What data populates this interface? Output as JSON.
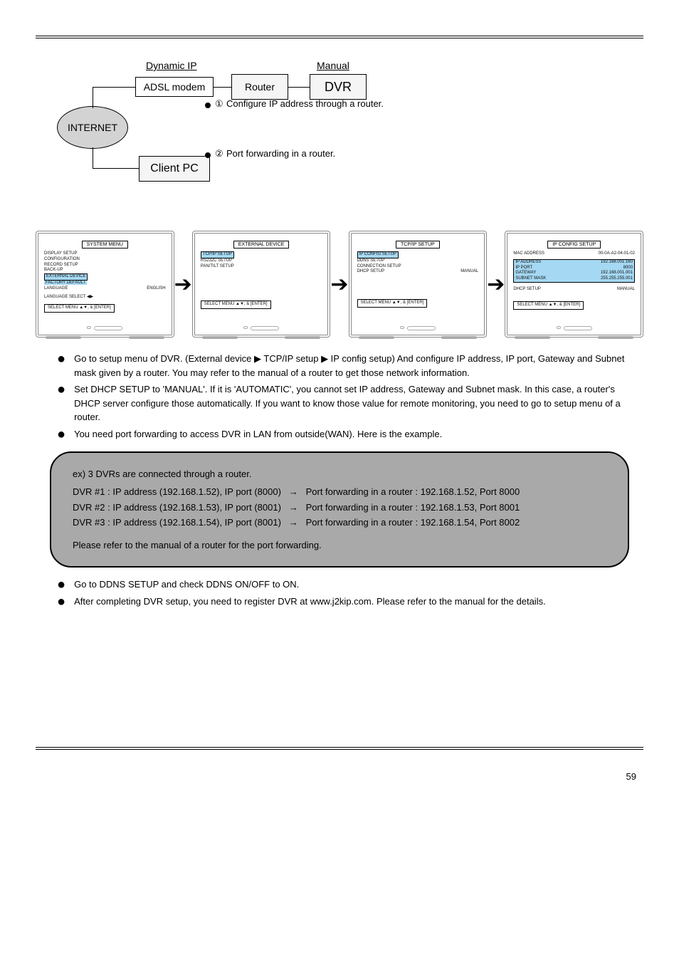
{
  "diagram": {
    "label_dynamic_ip": "Dynamic IP",
    "label_manual": "Manual",
    "node_adsl": "ADSL modem",
    "node_router": "Router",
    "node_dvr": "DVR",
    "node_internet": "INTERNET",
    "node_client_pc": "Client PC",
    "caption1_num": "①",
    "caption1_text": "Configure IP address through a router.",
    "caption2_num": "②",
    "caption2_text": "Port forwarding in a router."
  },
  "screens": {
    "s1": {
      "title": "SYSTEM MENU",
      "items": [
        "DISPLAY SETUP",
        "CONFIGURATION",
        "RECORD SETUP",
        "BACK-UP"
      ],
      "hi1": "EXTERNAL DEVICE",
      "hi2": "FACTORY DEFAULT",
      "lang_row_l": "LANGUAGE",
      "lang_row_r": "ENGLISH",
      "lang_sel": "LANGUAGE SELECT  ◀▶",
      "footer": "SELECT MENU ▲▼, & [ENTER]"
    },
    "s2": {
      "title": "EXTERNAL DEVICE",
      "hi": "TCP/IP SETUP",
      "items": [
        "RS232C SETUP",
        "PAN/TILT SETUP"
      ],
      "footer": "SELECT MENU ▲▼, & [ENTER]"
    },
    "s3": {
      "title": "TCP/IP SETUP",
      "hi": "IP CONFIG SETUP",
      "items": [
        "DDNS SETUP",
        "CONNECTION SETUP"
      ],
      "dhcp_l": "DHCP SETUP",
      "dhcp_r": "MANUAL",
      "footer": "SELECT MENU ▲▼, & [ENTER]"
    },
    "s4": {
      "title": "IP CONFIG SETUP",
      "mac_l": "MAC ADDRESS",
      "mac_r": "00-0A-A2-04-01-02",
      "ip_l": "IP ADDRESS",
      "ip_r": "192.168.001.160",
      "port_l": "IP PORT",
      "port_r": "8000",
      "gw_l": "GATEWAY",
      "gw_r": "192.168.001.001",
      "sm_l": "SUBNET MASK",
      "sm_r": "255.255.255.001",
      "dhcp_l": "DHCP SETUP",
      "dhcp_r": "MANUAL",
      "footer": "SELECT MENU ▲▼, & [ENTER]"
    }
  },
  "bullets": {
    "b1_a": "Go to setup menu of DVR. (External device ",
    "b1_play": "▶",
    "b1_b": " TCP/IP setup ",
    "b1_c": " IP config setup) And configure IP address, IP port, Gateway and Subnet mask given by a router. You may refer to the manual of a router to get those network information.",
    "b2": "Set DHCP SETUP to 'MANUAL'. If it is 'AUTOMATIC', you cannot set IP address, Gateway and Subnet mask. In this case, a router's DHCP server configure those automatically. If you want to know those value for remote monitoring, you need to go to setup menu of a router.",
    "b3": "You need port forwarding to access DVR in LAN from outside(WAN). Here is the example.",
    "b4": "Go to DDNS SETUP and check DDNS ON/OFF to ON.",
    "b5": "After completing DVR setup, you need to register DVR at www.j2kip.com. Please refer to the manual for the details."
  },
  "notebox": {
    "title": "ex) 3 DVRs are connected through a router.",
    "r1a": "DVR #1 : IP address (192.168.1.52), IP port (8000)",
    "r1b": "Port forwarding in a router : 192.168.1.52, Port 8000",
    "r2a": "DVR #2 : IP address (192.168.1.53), IP port (8001)",
    "r2b": "Port forwarding in a router : 192.168.1.53, Port 8001",
    "r3a": "DVR #3 : IP address (192.168.1.54), IP port (8001)",
    "r3b": "Port forwarding in a router : 192.168.1.54, Port 8002",
    "foot": "Please refer to the manual of a router for the port forwarding."
  },
  "footer": {
    "page": "59"
  }
}
